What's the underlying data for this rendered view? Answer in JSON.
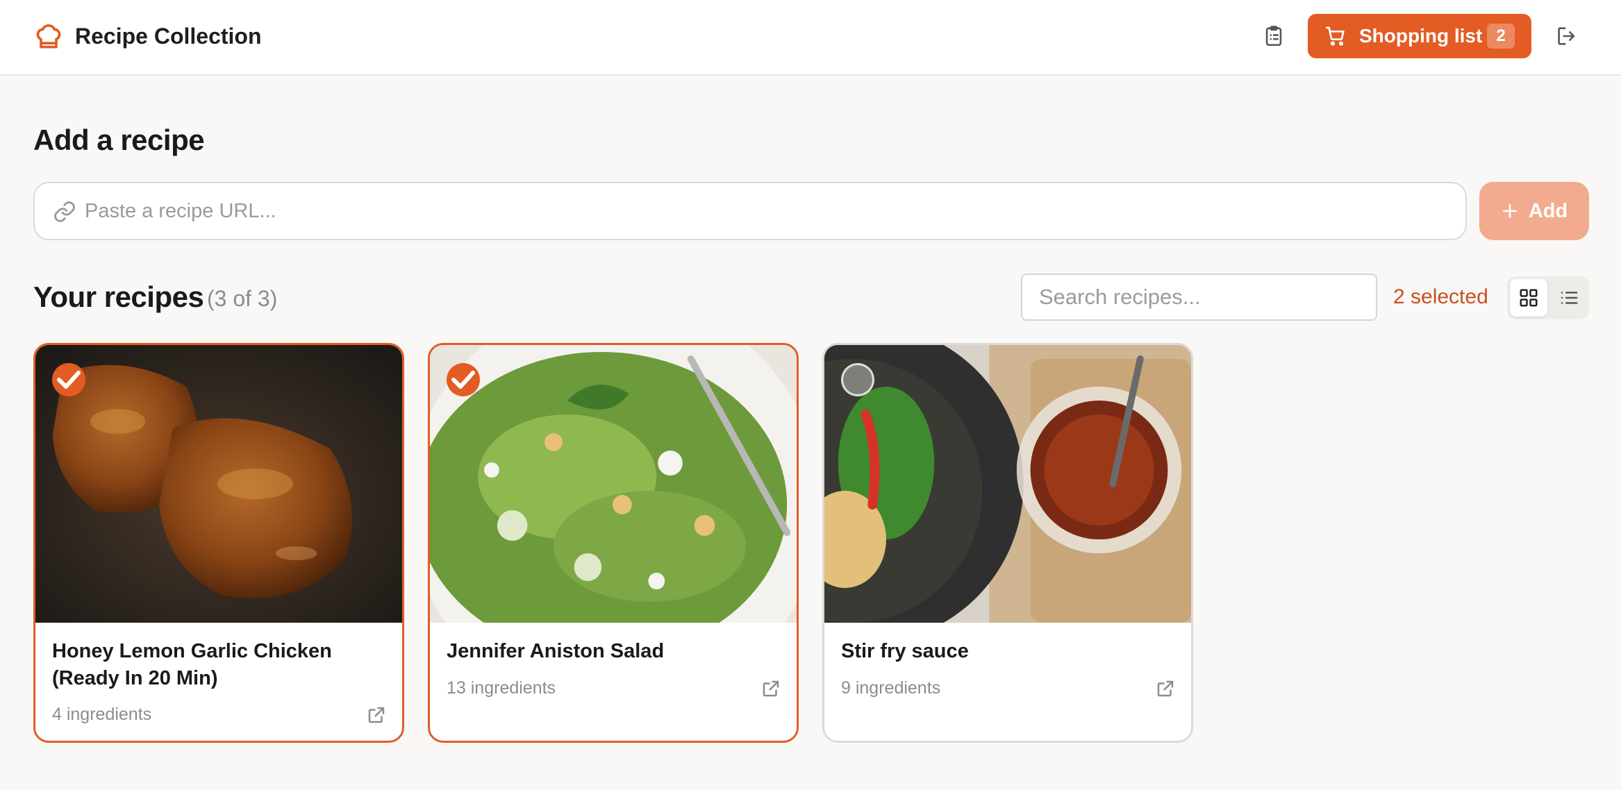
{
  "header": {
    "app_title": "Recipe Collection",
    "shopping_list_label": "Shopping list",
    "shopping_list_count": "2",
    "icons": [
      "chef-hat-icon",
      "clipboard-icon",
      "cart-icon",
      "logout-icon"
    ]
  },
  "add_recipe": {
    "title": "Add a recipe",
    "url_placeholder": "Paste a recipe URL...",
    "url_value": "",
    "add_label": "Add"
  },
  "recipes_section": {
    "title": "Your recipes",
    "count_label": "(3 of 3)",
    "search_placeholder": "Search recipes...",
    "selected_label": "2 selected",
    "view_mode": "grid"
  },
  "recipes": [
    {
      "title": "Honey Lemon Garlic Chicken (Ready In 20 Min)",
      "ingredients": "4 ingredients",
      "selected": true
    },
    {
      "title": "Jennifer Aniston Salad",
      "ingredients": "13 ingredients",
      "selected": true
    },
    {
      "title": "Stir fry sauce",
      "ingredients": "9 ingredients",
      "selected": false
    }
  ],
  "colors": {
    "accent": "#e35c24",
    "accent_light": "#f2ab8f",
    "selected_text": "#c9501d",
    "background": "#f9f8f6",
    "muted_text": "#8c8c8c"
  }
}
